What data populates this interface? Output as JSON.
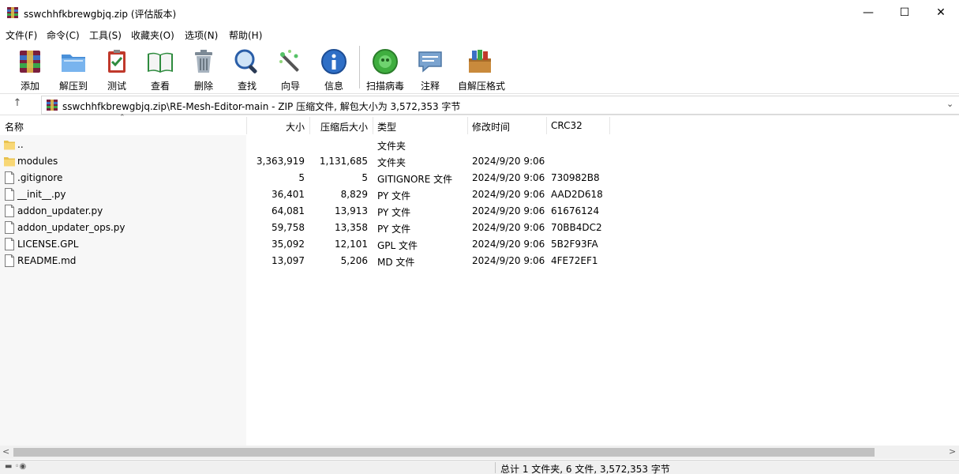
{
  "window": {
    "title": "sswchhfkbrewgbjq.zip (评估版本)",
    "minimize_glyph": "—",
    "maximize_glyph": "☐",
    "close_glyph": "✕"
  },
  "menu": [
    "文件(F)",
    "命令(C)",
    "工具(S)",
    "收藏夹(O)",
    "选项(N)",
    "帮助(H)"
  ],
  "toolbar": [
    {
      "label": "添加",
      "icon": "add-archive-icon"
    },
    {
      "label": "解压到",
      "icon": "extract-to-icon"
    },
    {
      "label": "测试",
      "icon": "test-icon"
    },
    {
      "label": "查看",
      "icon": "view-icon"
    },
    {
      "label": "删除",
      "icon": "delete-icon"
    },
    {
      "label": "查找",
      "icon": "find-icon"
    },
    {
      "label": "向导",
      "icon": "wizard-icon"
    },
    {
      "label": "信息",
      "icon": "info-icon"
    },
    {
      "label": "扫描病毒",
      "icon": "virus-scan-icon"
    },
    {
      "label": "注释",
      "icon": "comment-icon"
    },
    {
      "label": "自解压格式",
      "icon": "sfx-icon"
    }
  ],
  "address": {
    "up_glyph": "↑",
    "path": "sswchhfkbrewgbjq.zip\\RE-Mesh-Editor-main - ZIP 压缩文件, 解包大小为 3,572,353 字节",
    "dropdown_glyph": "⌄"
  },
  "columns": {
    "name": "名称",
    "size": "大小",
    "packed": "压缩后大小",
    "type": "类型",
    "modified": "修改时间",
    "crc": "CRC32",
    "sort_glyph": "⌃"
  },
  "files": [
    {
      "name": "..",
      "size": "",
      "packed": "",
      "type": "文件夹",
      "modified": "",
      "crc": "",
      "kind": "folder"
    },
    {
      "name": "modules",
      "size": "3,363,919",
      "packed": "1,131,685",
      "type": "文件夹",
      "modified": "2024/9/20 9:06",
      "crc": "",
      "kind": "folder"
    },
    {
      "name": ".gitignore",
      "size": "5",
      "packed": "5",
      "type": "GITIGNORE 文件",
      "modified": "2024/9/20 9:06",
      "crc": "730982B8",
      "kind": "file"
    },
    {
      "name": "__init__.py",
      "size": "36,401",
      "packed": "8,829",
      "type": "PY 文件",
      "modified": "2024/9/20 9:06",
      "crc": "AAD2D618",
      "kind": "file"
    },
    {
      "name": "addon_updater.py",
      "size": "64,081",
      "packed": "13,913",
      "type": "PY 文件",
      "modified": "2024/9/20 9:06",
      "crc": "61676124",
      "kind": "file"
    },
    {
      "name": "addon_updater_ops.py",
      "size": "59,758",
      "packed": "13,358",
      "type": "PY 文件",
      "modified": "2024/9/20 9:06",
      "crc": "70BB4DC2",
      "kind": "file"
    },
    {
      "name": "LICENSE.GPL",
      "size": "35,092",
      "packed": "12,101",
      "type": "GPL 文件",
      "modified": "2024/9/20 9:06",
      "crc": "5B2F93FA",
      "kind": "file"
    },
    {
      "name": "README.md",
      "size": "13,097",
      "packed": "5,206",
      "type": "MD 文件",
      "modified": "2024/9/20 9:06",
      "crc": "4FE72EF1",
      "kind": "file"
    }
  ],
  "scrollbar": {
    "left_glyph": "<",
    "right_glyph": ">"
  },
  "status": {
    "icons": "▬ ◦◉",
    "text": "总计 1 文件夹, 6 文件, 3,572,353 字节"
  }
}
